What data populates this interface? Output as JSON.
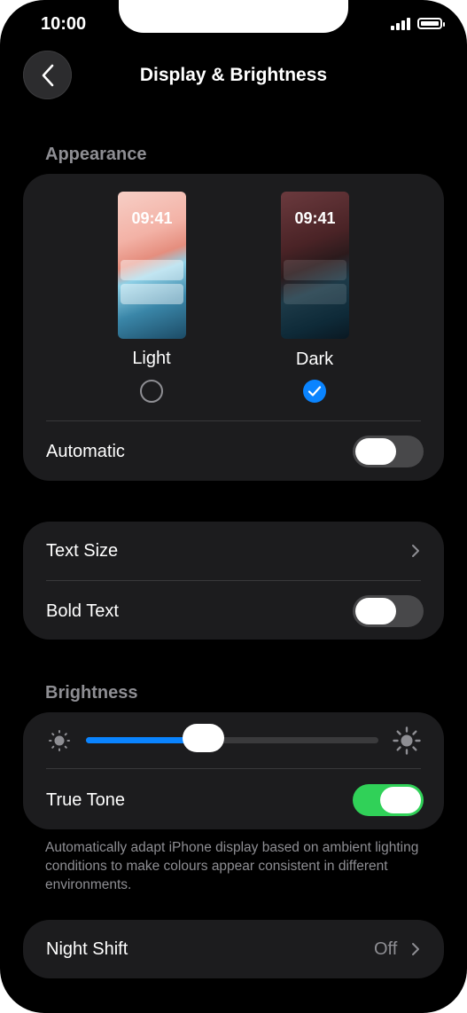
{
  "status_bar": {
    "time": "10:00"
  },
  "header": {
    "title": "Display & Brightness"
  },
  "appearance": {
    "section_label": "Appearance",
    "options": [
      {
        "label": "Light",
        "preview_time": "09:41",
        "selected": false
      },
      {
        "label": "Dark",
        "preview_time": "09:41",
        "selected": true
      }
    ],
    "automatic_label": "Automatic",
    "automatic_on": false
  },
  "text": {
    "text_size_label": "Text Size",
    "bold_text_label": "Bold Text",
    "bold_text_on": false
  },
  "brightness": {
    "section_label": "Brightness",
    "level": 0.4,
    "true_tone_label": "True Tone",
    "true_tone_on": true,
    "footnote": "Automatically adapt iPhone display based on ambient lighting conditions to make colours appear consistent in different environments."
  },
  "night_shift": {
    "label": "Night Shift",
    "value": "Off"
  },
  "colors": {
    "accent": "#0a84ff",
    "toggle_on": "#30d158",
    "card": "#1c1c1e"
  },
  "icons": [
    "back-chevron-icon",
    "signal-icon",
    "battery-icon",
    "checkmark-icon",
    "chevron-right-icon",
    "sun-small-icon",
    "sun-large-icon"
  ]
}
